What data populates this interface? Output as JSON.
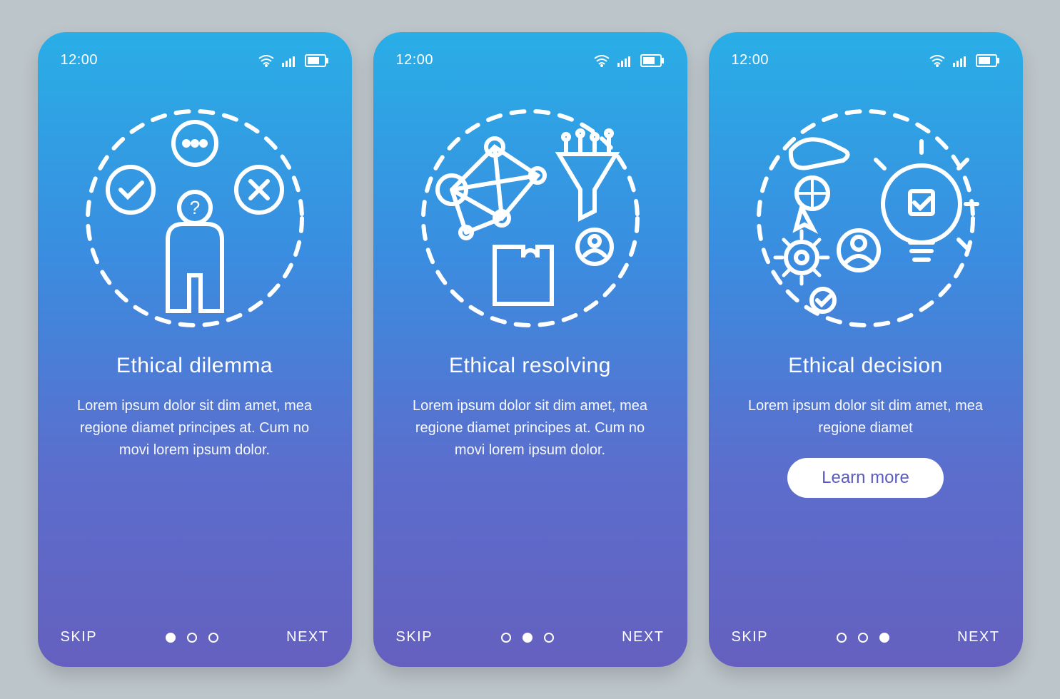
{
  "colors": {
    "gradient_top": "#29aee6",
    "gradient_bottom": "#6560bf",
    "text": "#ffffff",
    "cta_bg": "#ffffff",
    "cta_text": "#5c5cc0",
    "background": "#bcc5ca"
  },
  "status": {
    "time": "12:00",
    "icons": [
      "wifi-icon",
      "signal-icon",
      "battery-icon"
    ]
  },
  "screens": [
    {
      "title": "Ethical dilemma",
      "description": "Lorem ipsum dolor sit dim amet, mea regione diamet principes at. Cum no movi lorem ipsum dolor.",
      "skip_label": "SKIP",
      "next_label": "NEXT",
      "active_dot": 0,
      "has_cta": false,
      "illustration": "dilemma-person-icon"
    },
    {
      "title": "Ethical resolving",
      "description": "Lorem ipsum dolor sit dim amet, mea regione diamet principes at. Cum no movi lorem ipsum dolor.",
      "skip_label": "SKIP",
      "next_label": "NEXT",
      "active_dot": 1,
      "has_cta": false,
      "illustration": "network-puzzle-icon"
    },
    {
      "title": "Ethical decision",
      "description": "Lorem ipsum dolor sit dim amet, mea regione diamet",
      "skip_label": "SKIP",
      "next_label": "NEXT",
      "active_dot": 2,
      "has_cta": true,
      "cta_label": "Learn more",
      "illustration": "lightbulb-decision-icon"
    }
  ]
}
